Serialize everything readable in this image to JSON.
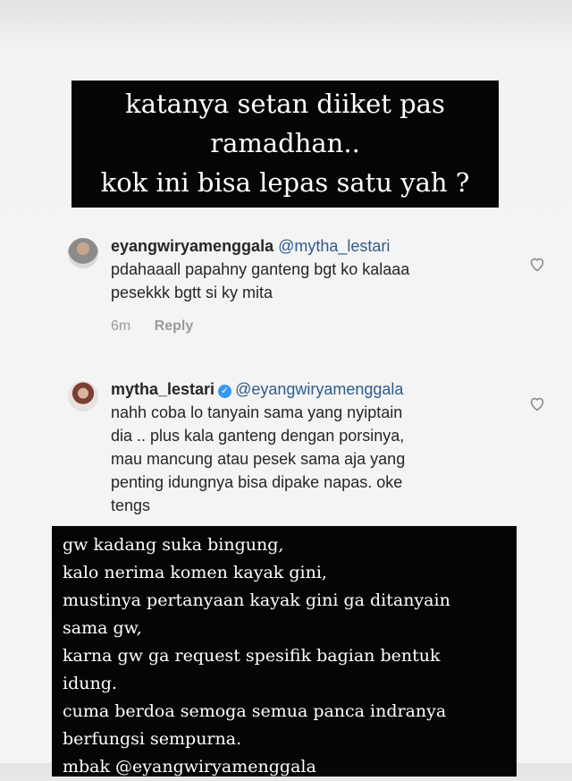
{
  "top_caption": {
    "lines": [
      "katanya setan diiket pas",
      "ramadhan..",
      "kok ini bisa lepas satu yah ?"
    ]
  },
  "comments": [
    {
      "username": "eyangwiryamenggala",
      "mention": "@mytha_lestari",
      "lines": [
        "pdahaaall papahny ganteng bgt ko kalaaa",
        "pesekkk bgtt si ky mita"
      ],
      "time": "6m",
      "reply_label": "Reply",
      "avatar": "user-avatar",
      "like_icon": "heart-outline-icon"
    },
    {
      "username": "mytha_lestari",
      "verified_icon": "verified-badge-icon",
      "mention": "@eyangwiryamenggala",
      "lines": [
        "nahh coba lo tanyain sama yang nyiptain",
        "dia .. plus kala ganteng dengan porsinya,",
        "mau mancung atau pesek sama aja yang",
        "penting idungnya bisa dipake napas. oke",
        "tengs"
      ],
      "avatar": "user-avatar",
      "like_icon": "heart-outline-icon"
    }
  ],
  "bottom_caption": {
    "lines": [
      "gw kadang suka bingung,",
      "kalo nerima komen kayak gini,",
      "mustinya pertanyaan kayak gini ga ditanyain",
      "sama gw,",
      "karna gw ga request spesifik bagian bentuk",
      "idung.",
      "cuma berdoa semoga semua panca indranya",
      "berfungsi sempurna.",
      "mbak @eyangwiryamenggala"
    ]
  }
}
